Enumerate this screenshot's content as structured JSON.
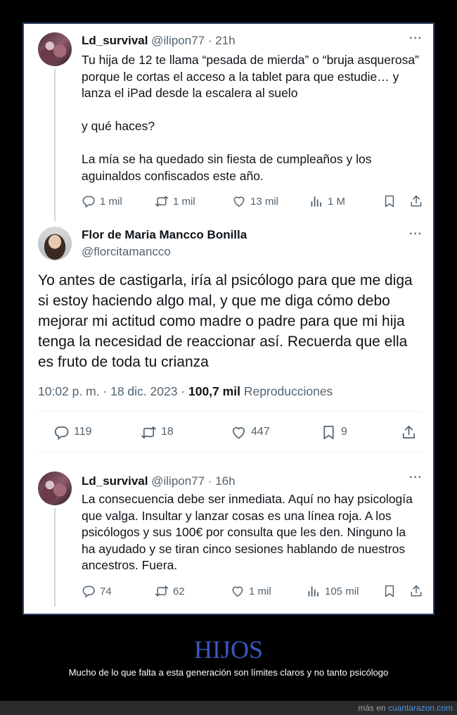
{
  "tweet1": {
    "name": "Ld_survival",
    "handle": "@ilipon77",
    "sep": " · ",
    "time": "21h",
    "p1": "Tu hija de 12 te llama “pesada de mierda” o “bruja asquerosa” porque le cortas el acceso a la tablet para que estudie… y lanza el iPad desde la escalera al suelo",
    "p2": "y qué haces?",
    "p3": "La mía se ha quedado sin fiesta de cumpleaños y los aguinaldos confiscados este año.",
    "replies": "1 mil",
    "retweets": "1 mil",
    "likes": "13 mil",
    "views": "1 M"
  },
  "tweet2": {
    "name": "Flor de Maria Mancco Bonilla",
    "handle": "@florcitamancco",
    "text": "Yo antes de castigarla, iría al psicólogo para que me diga si estoy haciendo algo mal, y que me diga cómo debo mejorar mi actitud como madre o padre para que mi hija tenga la necesidad de reaccionar así. Recuerda que ella es fruto de toda tu crianza",
    "timestamp": "10:02 p. m. · 18 dic. 2023 · ",
    "views_count": "100,7 mil",
    "views_label": " Reproducciones",
    "replies": "119",
    "retweets": "18",
    "likes": "447",
    "bookmarks": "9"
  },
  "tweet3": {
    "name": "Ld_survival",
    "handle": "@ilipon77",
    "sep": " · ",
    "time": "16h",
    "text": "La consecuencia debe ser inmediata. Aquí no hay psicología que valga. Insultar y lanzar cosas es una línea roja. A los psicólogos y sus 100€ por consulta que les den. Ninguno la ha ayudado y se tiran cinco sesiones hablando de nuestros ancestros. Fuera.",
    "replies": "74",
    "retweets": "62",
    "likes": "1 mil",
    "views": "105 mil"
  },
  "footer": {
    "title": "HIJOS",
    "subtitle": "Mucho de lo que falta a esta generación son límites claros y no tanto psicólogo",
    "credit_prefix": "más en ",
    "credit_site": "cuantarazon.com"
  },
  "icons": {
    "reply": "reply-icon",
    "retweet": "retweet-icon",
    "like": "like-icon",
    "views": "views-icon",
    "bookmark": "bookmark-icon",
    "share": "share-icon",
    "more": "more-icon"
  },
  "colors": {
    "background": "#000000",
    "frame_border": "#2b3f63",
    "text_primary": "#0f1419",
    "text_secondary": "#536471",
    "caption_title": "#3a57c4",
    "link": "#4a90e2"
  }
}
